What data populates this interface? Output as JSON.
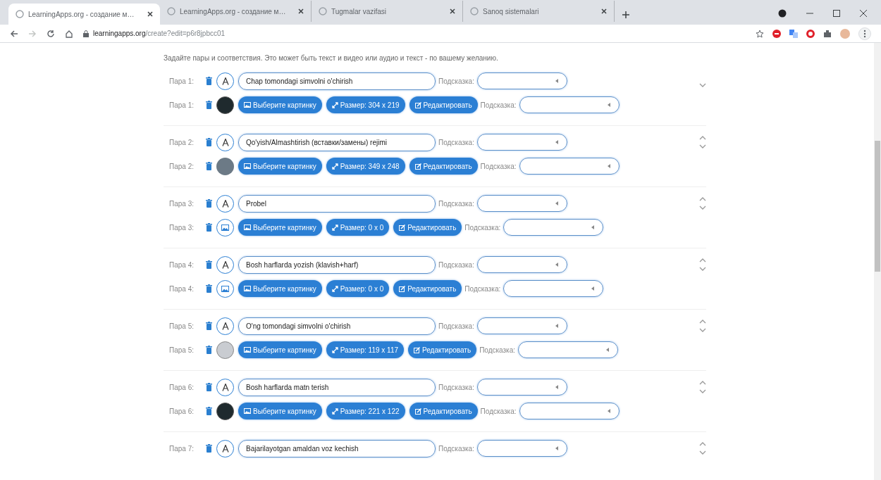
{
  "browser": {
    "tabs": [
      {
        "title": "LearningApps.org - создание м…",
        "selected": true
      },
      {
        "title": "LearningApps.org - создание м…",
        "selected": false
      },
      {
        "title": "Tugmalar vazifasi",
        "selected": false
      },
      {
        "title": "Sanoq sistemalari",
        "selected": false
      }
    ],
    "url_host": "learningapps.org",
    "url_path": "/create?edit=p6r8jpbcc01"
  },
  "instruction": "Задайте пары и соответствия. Это может быть текст и видео или аудио и текст - по вашему желанию.",
  "pairs": [
    {
      "text_row": {
        "label": "Пара 1:",
        "value": "Chap tomondagi simvolni o'chirish",
        "hint_label": "Подсказка:"
      },
      "image_row": {
        "label": "Пара 1:",
        "thumbnail": {
          "kind": "dark"
        },
        "choose": "Выберите картинку",
        "size": "Размер: 304 x 219",
        "edit": "Редактировать",
        "hint_label": "Подсказка:"
      },
      "can_move_up": false,
      "can_move_down": true
    },
    {
      "text_row": {
        "label": "Пара 2:",
        "value": "Qo'yish/Almashtirish (вставки/замены) rejimi",
        "hint_label": "Подсказка:"
      },
      "image_row": {
        "label": "Пара 2:",
        "thumbnail": {
          "kind": "grid"
        },
        "choose": "Выберите картинку",
        "size": "Размер: 349 x 248",
        "edit": "Редактировать",
        "hint_label": "Подсказка:"
      },
      "can_move_up": true,
      "can_move_down": true
    },
    {
      "text_row": {
        "label": "Пара 3:",
        "value": "Probel",
        "hint_label": "Подсказка:"
      },
      "image_row": {
        "label": "Пара 3:",
        "thumbnail": {
          "kind": "none"
        },
        "choose": "Выберите картинку",
        "size": "Размер: 0 x 0",
        "edit": "Редактировать",
        "hint_label": "Подсказка:"
      },
      "can_move_up": true,
      "can_move_down": true
    },
    {
      "text_row": {
        "label": "Пара 4:",
        "value": "Bosh harflarda yozish (klavish+harf)",
        "hint_label": "Подсказка:"
      },
      "image_row": {
        "label": "Пара 4:",
        "thumbnail": {
          "kind": "none"
        },
        "choose": "Выберите картинку",
        "size": "Размер: 0 x 0",
        "edit": "Редактировать",
        "hint_label": "Подсказка:"
      },
      "can_move_up": true,
      "can_move_down": true
    },
    {
      "text_row": {
        "label": "Пара 5:",
        "value": "O'ng tomondagi simvolni o'chirish",
        "hint_label": "Подсказка:"
      },
      "image_row": {
        "label": "Пара 5:",
        "thumbnail": {
          "kind": "light"
        },
        "choose": "Выберите картинку",
        "size": "Размер: 119 x 117",
        "edit": "Редактировать",
        "hint_label": "Подсказка:"
      },
      "can_move_up": true,
      "can_move_down": true
    },
    {
      "text_row": {
        "label": "Пара 6:",
        "value": "Bosh harflarda matn terish",
        "hint_label": "Подсказка:"
      },
      "image_row": {
        "label": "Пара 6:",
        "thumbnail": {
          "kind": "dark"
        },
        "choose": "Выберите картинку",
        "size": "Размер: 221 x 122",
        "edit": "Редактировать",
        "hint_label": "Подсказка:"
      },
      "can_move_up": true,
      "can_move_down": true
    },
    {
      "text_row": {
        "label": "Пара 7:",
        "value": "Bajarilayotgan amaldan voz kechish",
        "hint_label": "Подсказка:"
      },
      "can_move_up": true,
      "can_move_down": true
    }
  ]
}
